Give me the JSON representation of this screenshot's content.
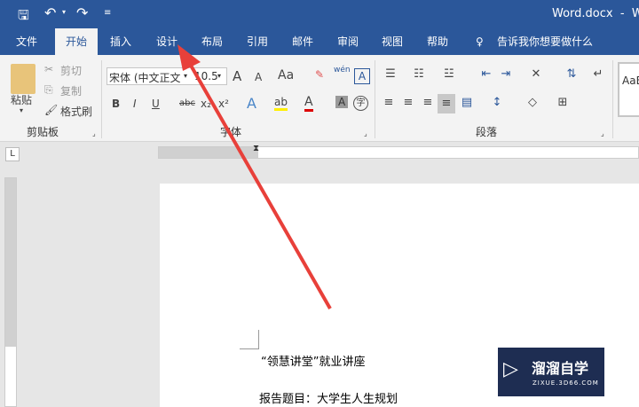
{
  "title": "Word.docx  -  W",
  "quick_access": {
    "save": "save-icon",
    "undo": "undo-icon",
    "redo": "redo-icon",
    "customize": "customize-icon"
  },
  "tabs": [
    "文件",
    "开始",
    "插入",
    "设计",
    "布局",
    "引用",
    "邮件",
    "审阅",
    "视图",
    "帮助"
  ],
  "tell_me": "告诉我你想要做什么",
  "clipboard": {
    "paste": "粘贴",
    "cut": "剪切",
    "copy": "复制",
    "format_painter": "格式刷",
    "group": "剪贴板"
  },
  "font": {
    "name": "宋体 (中文正文",
    "size": "10.5",
    "grow": "A",
    "shrink": "A",
    "case": "Aa",
    "bold": "B",
    "italic": "I",
    "underline": "U",
    "strike": "abc",
    "sub": "x₂",
    "sup": "x²",
    "pinyin": "wén",
    "border_char": "A",
    "shade_char": "A",
    "circle_char": "字",
    "group": "字体"
  },
  "paragraph": {
    "group": "段落"
  },
  "styles": {
    "preview": "AaB"
  },
  "ruler": {
    "tab_selector": "L"
  },
  "document": {
    "line1": "“领慧讲堂”就业讲座",
    "line2": "报告题目：大学生人生规划"
  },
  "watermark": {
    "name": "溜溜自学",
    "url": "ZIXUE.3D66.COM"
  },
  "colors": {
    "brand": "#2b579a",
    "arrow": "#e8403a"
  }
}
